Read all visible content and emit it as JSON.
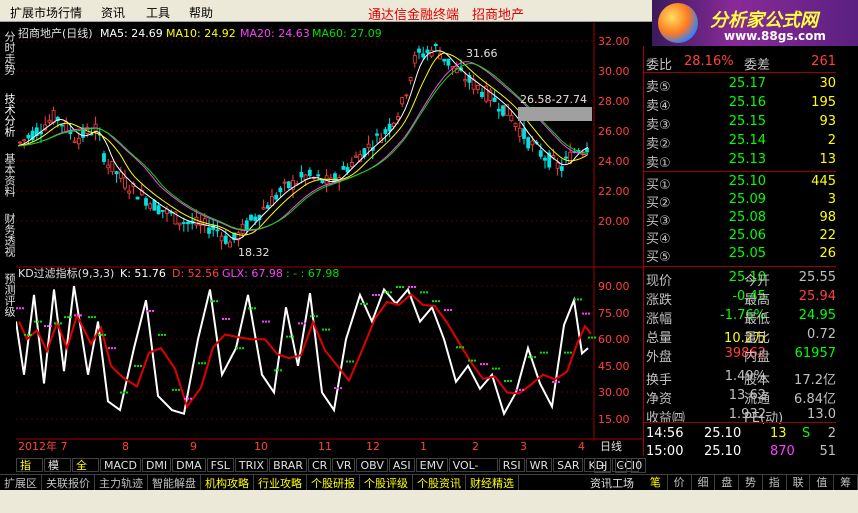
{
  "menubar": {
    "items": [
      "扩展市场行情",
      "资讯",
      "工具",
      "帮助"
    ],
    "title_app": "通达信金融终端",
    "title_stock": "招商地产"
  },
  "side_tabs": [
    "分时走势",
    "技术分析",
    "基本资料",
    "财务透视",
    "预测评级"
  ],
  "main_chart": {
    "legend_name": "招商地产(日线)",
    "ma": [
      {
        "label": "MA5: 24.69",
        "color": "#ffffff"
      },
      {
        "label": "MA10: 24.92",
        "color": "#ffff00"
      },
      {
        "label": "MA20: 24.63",
        "color": "#ff40ff"
      },
      {
        "label": "MA60: 27.09",
        "color": "#00e000"
      }
    ],
    "y_ticks": [
      "32.00",
      "30.00",
      "28.00",
      "26.00",
      "24.00",
      "22.00",
      "20.00"
    ],
    "hi_label": "31.66",
    "lo_label": "18.32",
    "range_label": "26.58-27.74"
  },
  "kd_chart": {
    "legend_name": "KD过滤指标(9,3,3)",
    "k_label": "K: 51.76",
    "d_label": "D: 52.56",
    "glx_label": "GLX: 67.98",
    "extra_label": ": - : 67.98",
    "y_ticks": [
      "90.00",
      "75.00",
      "60.00",
      "45.00",
      "30.00",
      "15.00"
    ]
  },
  "x_axis": {
    "labels": [
      "2012年 7",
      "8",
      "9",
      "10",
      "11",
      "12",
      "1",
      "2",
      "3",
      "4"
    ],
    "period": "日线"
  },
  "quote": {
    "wei_bi": {
      "label": "委比",
      "value": "28.16%"
    },
    "wei_cha": {
      "label": "委差",
      "value": "261"
    },
    "sell": [
      {
        "label": "卖⑤",
        "price": "25.17",
        "vol": "30"
      },
      {
        "label": "卖④",
        "price": "25.16",
        "vol": "195"
      },
      {
        "label": "卖③",
        "price": "25.15",
        "vol": "93"
      },
      {
        "label": "卖②",
        "price": "25.14",
        "vol": "2"
      },
      {
        "label": "卖①",
        "price": "25.13",
        "vol": "13"
      }
    ],
    "buy": [
      {
        "label": "买①",
        "price": "25.10",
        "vol": "445"
      },
      {
        "label": "买②",
        "price": "25.09",
        "vol": "3"
      },
      {
        "label": "买③",
        "price": "25.08",
        "vol": "98"
      },
      {
        "label": "买④",
        "price": "25.06",
        "vol": "22"
      },
      {
        "label": "买⑤",
        "price": "25.05",
        "vol": "26"
      }
    ],
    "stats": [
      {
        "l1": "现价",
        "v1": "25.10",
        "c1": "#00ff00",
        "l2": "今开",
        "v2": "25.55",
        "c2": "#c0c0c0"
      },
      {
        "l1": "涨跌",
        "v1": "-0.45",
        "c1": "#00ff00",
        "l2": "最高",
        "v2": "25.94",
        "c2": "#ff4040"
      },
      {
        "l1": "涨幅",
        "v1": "-1.76%",
        "c1": "#00ff00",
        "l2": "最低",
        "v2": "24.95",
        "c2": "#00ff00"
      },
      {
        "l1": "总量",
        "v1": "10.2万",
        "c1": "#ffff00",
        "l2": "量比",
        "v2": "0.72",
        "c2": "#c0c0c0"
      },
      {
        "l1": "外盘",
        "v1": "39862",
        "c1": "#ff4040",
        "l2": "内盘",
        "v2": "61957",
        "c2": "#00ff00"
      },
      {
        "l1": "换手",
        "v1": "1.49%",
        "c1": "#c0c0c0",
        "l2": "股本",
        "v2": "17.2亿",
        "c2": "#c0c0c0"
      },
      {
        "l1": "净资",
        "v1": "13.62",
        "c1": "#c0c0c0",
        "l2": "流通",
        "v2": "6.84亿",
        "c2": "#c0c0c0"
      },
      {
        "l1": "收益㈣",
        "v1": "1.932",
        "c1": "#c0c0c0",
        "l2": "PE(动)",
        "v2": "13.0",
        "c2": "#c0c0c0"
      }
    ],
    "ticks": [
      {
        "time": "14:56",
        "price": "25.10",
        "vol": "13",
        "flag": "S",
        "n": "2"
      },
      {
        "time": "15:00",
        "price": "25.10",
        "vol": "870",
        "flag": "",
        "n": "51"
      }
    ]
  },
  "logo": {
    "title": "分析家公式网",
    "url": "www.88gs.com"
  },
  "bottom_tabs": [
    "指标",
    "模板",
    "全部",
    "MACD",
    "DMI",
    "DMA",
    "FSL",
    "TRIX",
    "BRAR",
    "CR",
    "VR",
    "OBV",
    "ASI",
    "EMV",
    "VOL-TDX",
    "RSI",
    "WR",
    "SAR",
    "KDJ",
    "CCI"
  ],
  "bottom_controls": [
    "+",
    "-",
    "0"
  ],
  "status_items": [
    "扩展区",
    "关联报价",
    "主力轨迹",
    "智能解盘",
    "机构攻略",
    "行业攻略",
    "个股研报",
    "个股评级",
    "个股资讯",
    "财经精选"
  ],
  "status_right": "资讯工场",
  "right_tabs": [
    "笔",
    "价",
    "细",
    "盘",
    "势",
    "指",
    "联",
    "值",
    "筹"
  ]
}
